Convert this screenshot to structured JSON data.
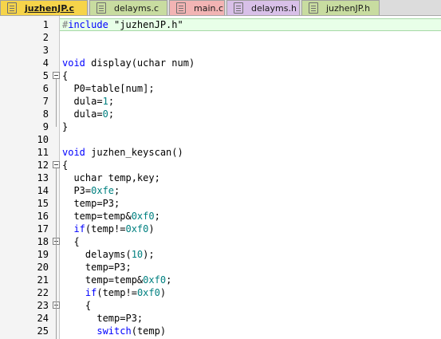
{
  "tabs": [
    {
      "label": "juzhenJP.c",
      "active": true,
      "color": "#f6d44a"
    },
    {
      "label": "delayms.c",
      "active": false,
      "color": "#c8dca0"
    },
    {
      "label": "main.c",
      "active": false,
      "color": "#f2b4b4"
    },
    {
      "label": "delayms.h",
      "active": false,
      "color": "#d8c0e8"
    },
    {
      "label": "juzhenJP.h",
      "active": false,
      "color": "#c8dca0"
    }
  ],
  "lines": [
    {
      "n": "1",
      "fold": "none",
      "code": [
        [
          "pre",
          "#"
        ],
        [
          "kw",
          "include"
        ],
        [
          "str",
          " \"juzhenJP.h\""
        ]
      ]
    },
    {
      "n": "2",
      "fold": "none",
      "code": []
    },
    {
      "n": "3",
      "fold": "none",
      "code": []
    },
    {
      "n": "4",
      "fold": "none",
      "code": [
        [
          "kw",
          "void"
        ],
        [
          "t",
          " display(uchar num)"
        ]
      ]
    },
    {
      "n": "5",
      "fold": "open",
      "code": [
        [
          "t",
          "{"
        ]
      ]
    },
    {
      "n": "6",
      "fold": "line",
      "code": [
        [
          "t",
          "  P0=table[num];"
        ]
      ]
    },
    {
      "n": "7",
      "fold": "line",
      "code": [
        [
          "t",
          "  dula="
        ],
        [
          "num",
          "1"
        ],
        [
          "t",
          ";"
        ]
      ]
    },
    {
      "n": "8",
      "fold": "line",
      "code": [
        [
          "t",
          "  dula="
        ],
        [
          "num",
          "0"
        ],
        [
          "t",
          ";"
        ]
      ]
    },
    {
      "n": "9",
      "fold": "end",
      "code": [
        [
          "t",
          "}"
        ]
      ]
    },
    {
      "n": "10",
      "fold": "none",
      "code": []
    },
    {
      "n": "11",
      "fold": "none",
      "code": [
        [
          "kw",
          "void"
        ],
        [
          "t",
          " juzhen_keyscan()"
        ]
      ]
    },
    {
      "n": "12",
      "fold": "open",
      "code": [
        [
          "t",
          "{"
        ]
      ]
    },
    {
      "n": "13",
      "fold": "line",
      "code": [
        [
          "t",
          "  uchar temp,key;"
        ]
      ]
    },
    {
      "n": "14",
      "fold": "line",
      "code": [
        [
          "t",
          "  P3="
        ],
        [
          "num",
          "0xfe"
        ],
        [
          "t",
          ";"
        ]
      ]
    },
    {
      "n": "15",
      "fold": "line",
      "code": [
        [
          "t",
          "  temp=P3;"
        ]
      ]
    },
    {
      "n": "16",
      "fold": "line",
      "code": [
        [
          "t",
          "  temp=temp&"
        ],
        [
          "num",
          "0xf0"
        ],
        [
          "t",
          ";"
        ]
      ]
    },
    {
      "n": "17",
      "fold": "line",
      "code": [
        [
          "t",
          "  "
        ],
        [
          "kw",
          "if"
        ],
        [
          "t",
          "(temp!="
        ],
        [
          "num",
          "0xf0"
        ],
        [
          "t",
          ")"
        ]
      ]
    },
    {
      "n": "18",
      "fold": "open",
      "code": [
        [
          "t",
          "  {"
        ]
      ]
    },
    {
      "n": "19",
      "fold": "line",
      "code": [
        [
          "t",
          "    delayms("
        ],
        [
          "num",
          "10"
        ],
        [
          "t",
          ");"
        ]
      ]
    },
    {
      "n": "20",
      "fold": "line",
      "code": [
        [
          "t",
          "    temp=P3;"
        ]
      ]
    },
    {
      "n": "21",
      "fold": "line",
      "code": [
        [
          "t",
          "    temp=temp&"
        ],
        [
          "num",
          "0xf0"
        ],
        [
          "t",
          ";"
        ]
      ]
    },
    {
      "n": "22",
      "fold": "line",
      "code": [
        [
          "t",
          "    "
        ],
        [
          "kw",
          "if"
        ],
        [
          "t",
          "(temp!="
        ],
        [
          "num",
          "0xf0"
        ],
        [
          "t",
          ")"
        ]
      ]
    },
    {
      "n": "23",
      "fold": "open",
      "code": [
        [
          "t",
          "    {"
        ]
      ]
    },
    {
      "n": "24",
      "fold": "line",
      "code": [
        [
          "t",
          "      temp=P3;"
        ]
      ]
    },
    {
      "n": "25",
      "fold": "line",
      "code": [
        [
          "t",
          "      "
        ],
        [
          "kw",
          "switch"
        ],
        [
          "t",
          "(temp)"
        ]
      ]
    }
  ]
}
